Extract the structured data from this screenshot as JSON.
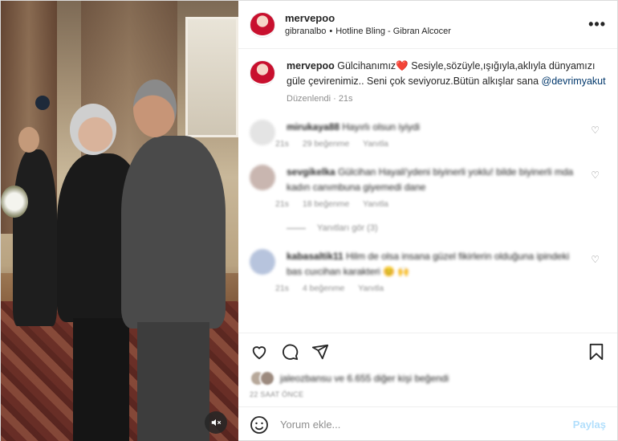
{
  "post": {
    "username": "mervepoo",
    "audio_user": "gibranalbo",
    "audio_track": "Hotline Bling - Gibran Alcocer",
    "more_label": "•••"
  },
  "caption": {
    "username": "mervepoo",
    "text_part1": "Gülcihanımız",
    "heart": "❤️",
    "text_part2": " Sesiyle,sözüyle,ışığıyla,aklıyla dünyamızı güle çevirenimiz.. Seni çok seviyoruz.Bütün alkışlar sana ",
    "mention": "@devrimyakut",
    "edited": "Düzenlendi · 21s"
  },
  "comments": [
    {
      "username": "mirukaya88",
      "text": "Hayırlı olsun iyiydi",
      "time": "21s",
      "likes": "29 beğenme",
      "reply": "Yanıtla",
      "avatar_color": "#e4e4e4"
    },
    {
      "username": "sevgikelka",
      "text": "Gülcihan Hayali'ydeni biyinerli yoklu! bilde biyinerli mda kadın canımbuna giyemedi dane",
      "time": "21s",
      "likes": "18 beğenme",
      "reply": "Yanıtla",
      "avatar_color": "#c9b6b0",
      "view_replies": "Yanıtları gör (3)"
    },
    {
      "username": "kabasaltik11",
      "text": "Hilm de olsa insana güzel fikirlerin olduğuna ipindeki bas cuıcihan karakteri",
      "emoji": "😊 🙌",
      "time": "21s",
      "likes": "4 beğenme",
      "reply": "Yanıtla",
      "avatar_color": "#b7c4dd"
    }
  ],
  "likes": {
    "text": "jaleozbansu ve 6.655 diğer kişi beğendi"
  },
  "time_ago": "22 SAAT ÖNCE",
  "add_comment": {
    "placeholder": "Yorum ekle...",
    "post_label": "Paylaş"
  },
  "icons": {
    "mute": "speaker-muted-icon",
    "like": "heart-icon",
    "comment": "comment-icon",
    "share": "send-icon",
    "save": "bookmark-icon",
    "emoji": "smiley-icon"
  }
}
